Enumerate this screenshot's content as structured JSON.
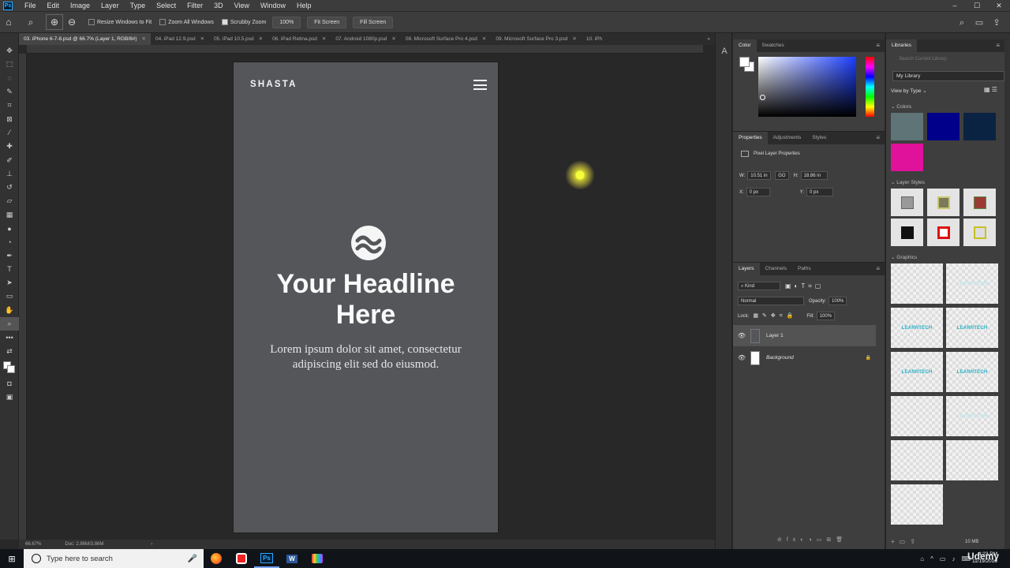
{
  "menu": {
    "logo": "Ps",
    "items": [
      "File",
      "Edit",
      "Image",
      "Layer",
      "Type",
      "Select",
      "Filter",
      "3D",
      "View",
      "Window",
      "Help"
    ],
    "window_controls": [
      "–",
      "☐",
      "✕"
    ]
  },
  "options_bar": {
    "resize_windows_label": "Resize Windows to Fit",
    "zoom_all_label": "Zoom All Windows",
    "scrubby_zoom_label": "Scrubby Zoom",
    "zoom_value": "100%",
    "fit_screen_label": "Fit Screen",
    "fill_screen_label": "Fill Screen"
  },
  "tabs": [
    {
      "label": "03. iPhone 6-7-8.psd @ 66.7% (Layer 1, RGB/8#)",
      "active": true
    },
    {
      "label": "04. iPad 12.9.psd",
      "active": false
    },
    {
      "label": "05. iPad 10.5.psd",
      "active": false
    },
    {
      "label": "06. iPad Retina.psd",
      "active": false
    },
    {
      "label": "07. Android 1080p.psd",
      "active": false
    },
    {
      "label": "08. Microsoft Surface Pro 4.psd",
      "active": false
    },
    {
      "label": "09. Microsoft Surface Pro 3.psd",
      "active": false
    },
    {
      "label": "10. iPh",
      "active": false
    }
  ],
  "document": {
    "brand": "SHASTA",
    "headline_line1": "Your Headline",
    "headline_line2": "Here",
    "body_line1": "Lorem ipsum dolor sit amet, consectetur",
    "body_line2": "adipiscing elit sed do eiusmod."
  },
  "status": {
    "zoom": "66.67%",
    "doc": "Doc: 2.86M/3.86M"
  },
  "color_panel": {
    "tabs": [
      "Color",
      "Swatches"
    ]
  },
  "properties_panel": {
    "tabs": [
      "Properties",
      "Adjustments",
      "Styles"
    ],
    "title": "Pixel Layer Properties",
    "w_label": "W:",
    "w_value": "10.51 in",
    "link_label": "GO",
    "h_label": "H:",
    "h_value": "18.86 in",
    "x_label": "X:",
    "x_value": "0 px",
    "y_label": "Y:",
    "y_value": "0 px"
  },
  "layers_panel": {
    "tabs": [
      "Layers",
      "Channels",
      "Paths"
    ],
    "filter": "Kind",
    "blend_mode": "Normal",
    "opacity_label": "Opacity:",
    "opacity_value": "100%",
    "lock_label": "Lock:",
    "fill_label": "Fill:",
    "fill_value": "100%",
    "layers": [
      {
        "name": "Layer 1",
        "selected": true
      },
      {
        "name": "Background",
        "selected": false
      }
    ]
  },
  "libraries": {
    "tab": "Libraries",
    "search_placeholder": "Search Current Library",
    "library": "My Library",
    "view_by": "View by Type",
    "colors_heading": "Colors",
    "colors": [
      "#5f7477",
      "#00008b",
      "#0b2342",
      "#e0119a"
    ],
    "layer_styles_heading": "Layer Styles",
    "graphics_heading": "Graphics",
    "graphic_label": "LEARNTECH"
  },
  "taskbar": {
    "search_placeholder": "Type here to search",
    "apps": [
      "firefox",
      "screen-recorder",
      "Ps",
      "W",
      "paint"
    ],
    "time": "4:23 PM",
    "date": "11/19/2019",
    "storage": "10 MB",
    "watermark": "Udemy"
  }
}
